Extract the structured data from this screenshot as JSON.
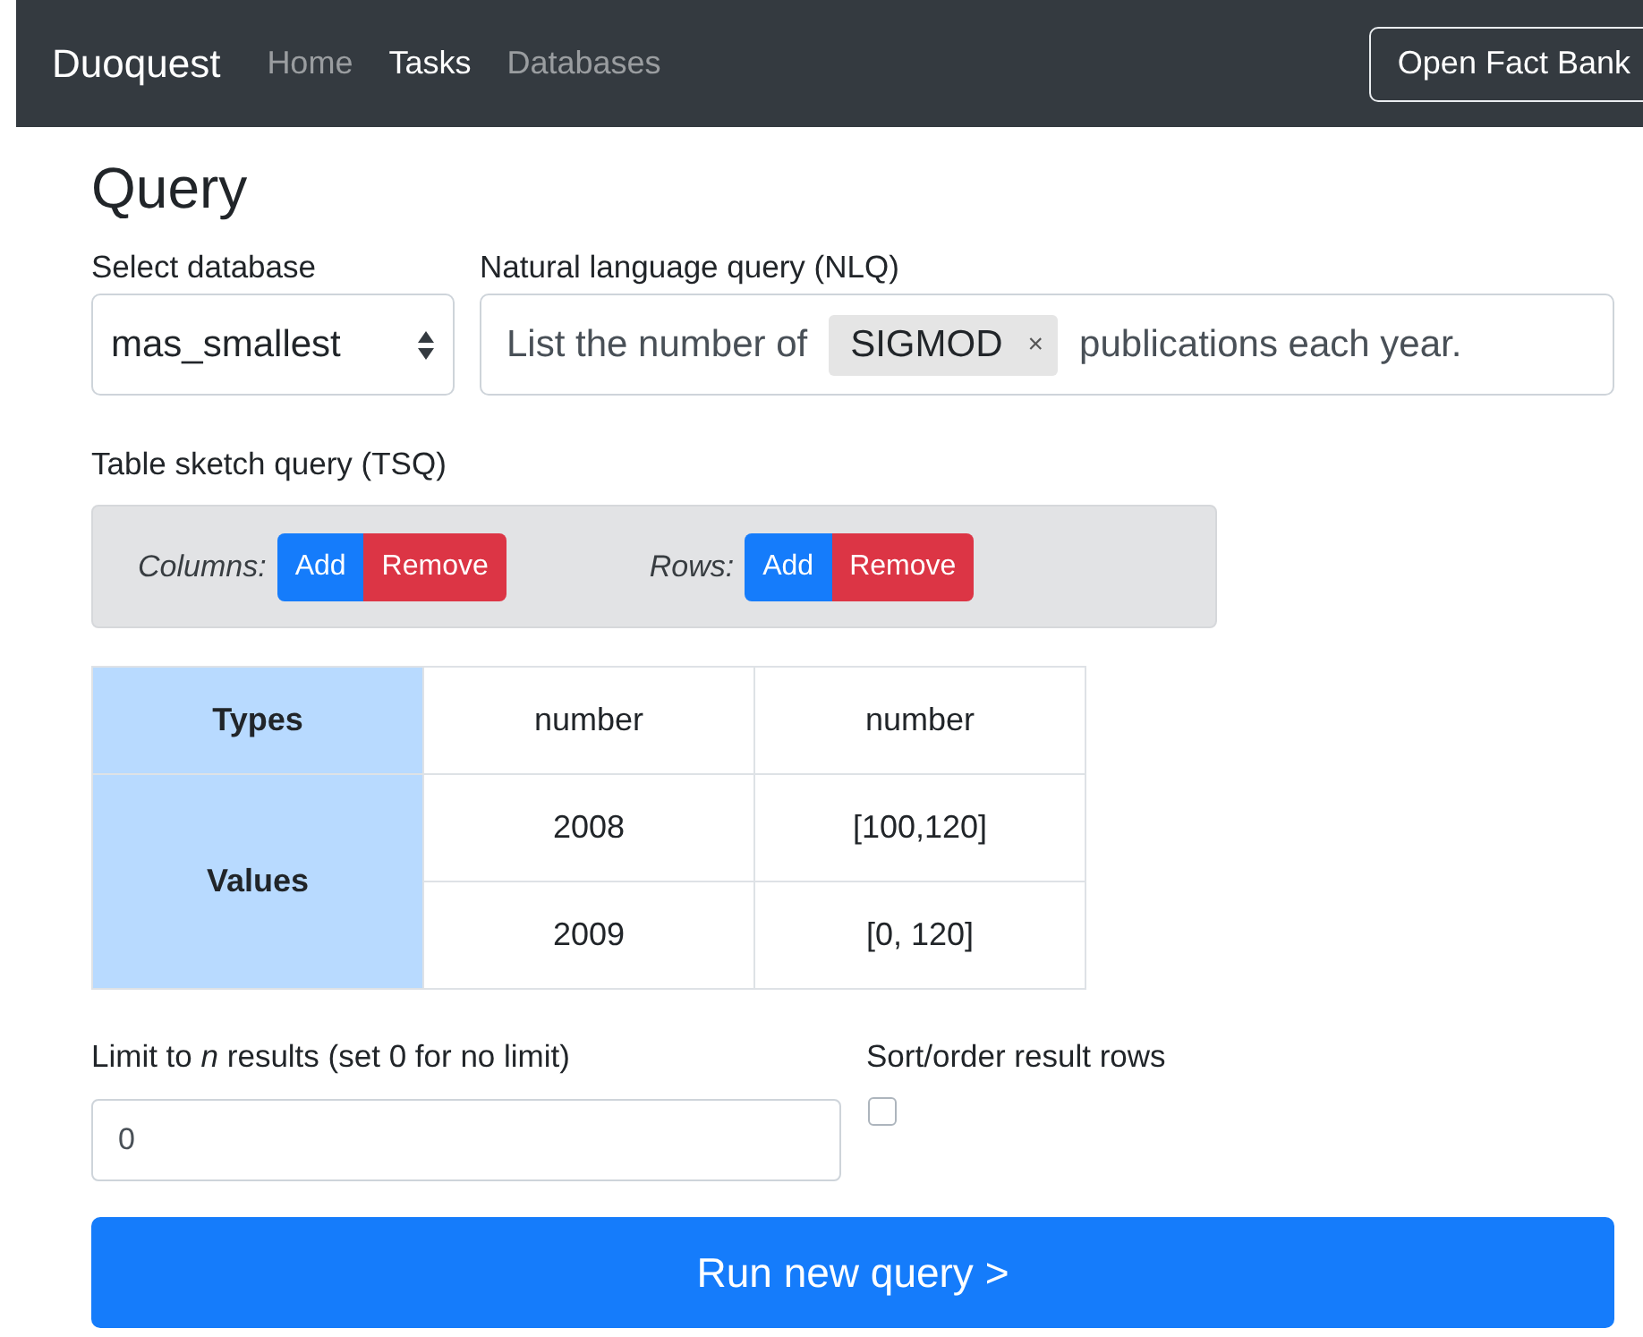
{
  "navbar": {
    "brand": "Duoquest",
    "links": [
      {
        "label": "Home",
        "selected": false
      },
      {
        "label": "Tasks",
        "selected": true
      },
      {
        "label": "Databases",
        "selected": false
      }
    ],
    "button": "Open Fact Bank"
  },
  "title": "Query",
  "database": {
    "label": "Select database",
    "value": "mas_smallest"
  },
  "nlq": {
    "label": "Natural language query (NLQ)",
    "parts": [
      {
        "kind": "text",
        "text": "List the number of"
      },
      {
        "kind": "tag",
        "text": "SIGMOD",
        "remove": "×"
      },
      {
        "kind": "text",
        "text": "publications each year."
      }
    ]
  },
  "tsq": {
    "label": "Table sketch query (TSQ)",
    "controls": [
      {
        "label": "Columns:",
        "add": "Add",
        "remove": "Remove"
      },
      {
        "label": "Rows:",
        "add": "Add",
        "remove": "Remove"
      }
    ],
    "table": {
      "types_header": "Types",
      "types": [
        "number",
        "number"
      ],
      "values_header": "Values",
      "values": [
        [
          "2008",
          "[100,120]"
        ],
        [
          "2009",
          "[0, 120]"
        ]
      ]
    }
  },
  "limit": {
    "label": "Limit to *n* results (set 0 for no limit)",
    "value": "0"
  },
  "sort": {
    "label": "Sort/order result rows",
    "checked": false
  },
  "run_button": "Run new query >"
}
